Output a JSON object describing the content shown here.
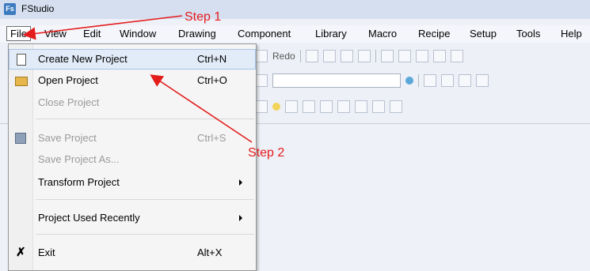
{
  "app": {
    "icon_text": "Fs",
    "title": "FStudio"
  },
  "menubar": [
    "File",
    "View",
    "Edit",
    "Window",
    "Drawing",
    "Component",
    "Library",
    "Macro",
    "Recipe",
    "Setup",
    "Tools",
    "Help"
  ],
  "toolbar": {
    "redo_label": "Redo"
  },
  "file_menu": {
    "items": [
      {
        "label": "Create New Project",
        "shortcut": "Ctrl+N",
        "icon": "new-document-icon"
      },
      {
        "label": "Open Project",
        "shortcut": "Ctrl+O",
        "icon": "open-folder-icon"
      },
      {
        "label": "Close Project",
        "shortcut": ""
      },
      {
        "label": "Save Project",
        "shortcut": "Ctrl+S",
        "icon": "save-disk-icon"
      },
      {
        "label": "Save Project As...",
        "shortcut": ""
      },
      {
        "label": "Transform Project",
        "shortcut": ""
      },
      {
        "label": "Project Used Recently",
        "shortcut": ""
      },
      {
        "label": "Exit",
        "shortcut": "Alt+X",
        "icon": "exit-x-icon"
      }
    ]
  },
  "annotations": {
    "step1": "Step 1",
    "step2": "Step 2",
    "color": "#e41c1c"
  }
}
